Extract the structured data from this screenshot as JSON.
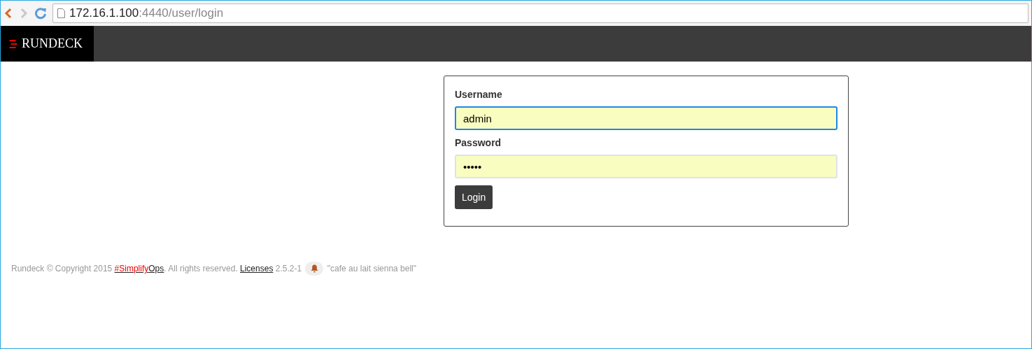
{
  "browser": {
    "address_host": "172.16.1.100",
    "address_path": ":4440/user/login"
  },
  "navbar": {
    "brand": "RUNDECK"
  },
  "login_form": {
    "fields": [
      {
        "label": "Username",
        "value": "admin",
        "focused": true
      },
      {
        "label": "Password",
        "value": "•••••",
        "focused": false
      }
    ],
    "button": "Login"
  },
  "footer": {
    "segments": [
      {
        "kind": "text",
        "text": "Rundeck © Copyright 2015 "
      },
      {
        "kind": "brand_link",
        "parts": [
          "#Simplify",
          "Ops"
        ]
      },
      {
        "kind": "text",
        "text": ". All rights reserved. "
      },
      {
        "kind": "link",
        "text": "Licenses"
      },
      {
        "kind": "text",
        "text": " 2.5.2-1 "
      },
      {
        "kind": "badge"
      },
      {
        "kind": "text",
        "text": " \"cafe au lait sienna bell\""
      }
    ]
  }
}
